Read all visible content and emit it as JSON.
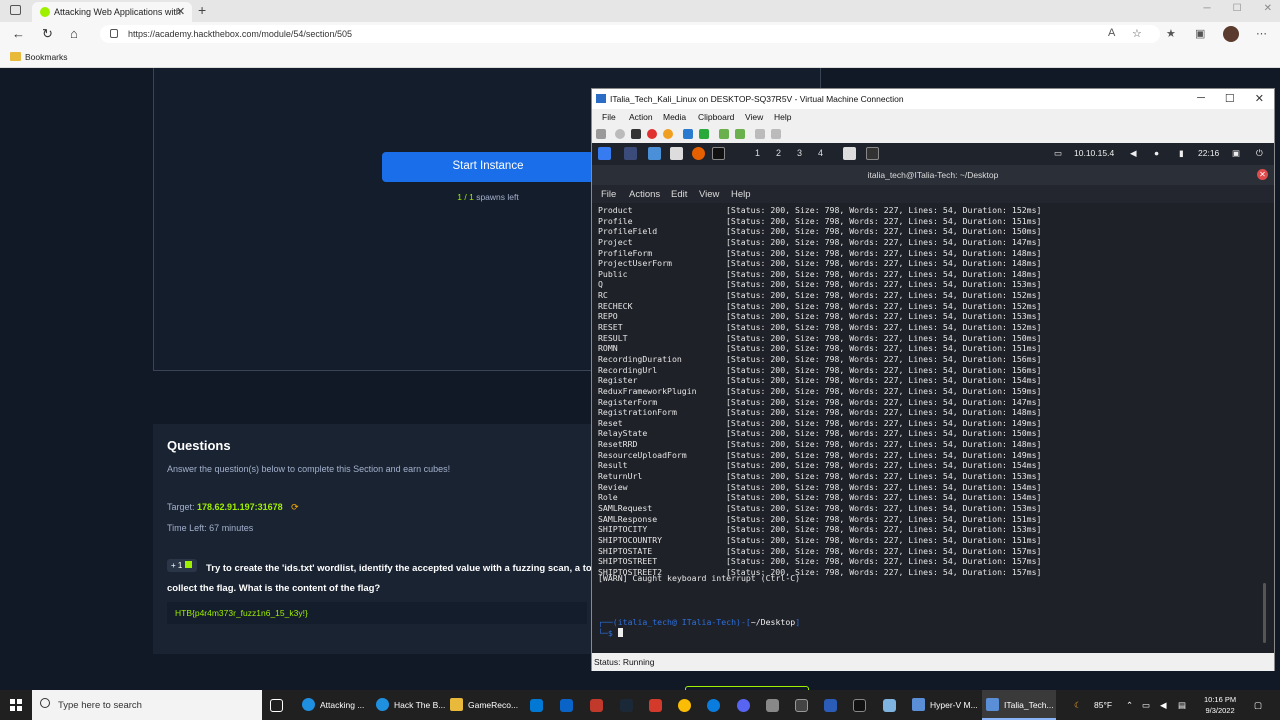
{
  "browser": {
    "tab_title": "Attacking Web Applications with",
    "url": "https://academy.hackthebox.com/module/54/section/505",
    "bookmarks_label": "Bookmarks"
  },
  "page": {
    "start_button": "Start Instance",
    "spawns_count": "1 / 1",
    "spawns_text": "spawns left",
    "questions_title": "Questions",
    "questions_desc": "Answer the question(s) below to complete this Section and earn cubes!",
    "target_label": "Target:",
    "target_ip": "178.62.91.197:31678",
    "time_left": "Time Left: 67 minutes",
    "cube_reward": "+ 1",
    "question_text": "Try to create the 'ids.txt' wordlist, identify the accepted value with a fuzzing scan, a to collect the flag. What is the content of the flag?",
    "flag": "HTB{p4r4m373r_fuzz1n6_15_k3y!}"
  },
  "vm": {
    "title": "ITalia_Tech_Kali_Linux on DESKTOP-SQ37R5V - Virtual Machine Connection",
    "menu": [
      "File",
      "Action",
      "Media",
      "Clipboard",
      "View",
      "Help"
    ],
    "status": "Status: Running",
    "kali": {
      "workspaces": [
        "1",
        "2",
        "3",
        "4"
      ],
      "ip": "10.10.15.4",
      "time": "22:16"
    },
    "terminal": {
      "title": "italia_tech@ITalia-Tech: ~/Desktop",
      "menu": [
        "File",
        "Actions",
        "Edit",
        "View",
        "Help"
      ],
      "rows": [
        [
          "Product",
          "[Status: 200, Size: 798, Words: 227, Lines: 54, Duration: 152ms]"
        ],
        [
          "Profile",
          "[Status: 200, Size: 798, Words: 227, Lines: 54, Duration: 151ms]"
        ],
        [
          "ProfileField",
          "[Status: 200, Size: 798, Words: 227, Lines: 54, Duration: 150ms]"
        ],
        [
          "Project",
          "[Status: 200, Size: 798, Words: 227, Lines: 54, Duration: 147ms]"
        ],
        [
          "ProfileForm",
          "[Status: 200, Size: 798, Words: 227, Lines: 54, Duration: 148ms]"
        ],
        [
          "ProjectUserForm",
          "[Status: 200, Size: 798, Words: 227, Lines: 54, Duration: 148ms]"
        ],
        [
          "Public",
          "[Status: 200, Size: 798, Words: 227, Lines: 54, Duration: 148ms]"
        ],
        [
          "Q",
          "[Status: 200, Size: 798, Words: 227, Lines: 54, Duration: 153ms]"
        ],
        [
          "RC",
          "[Status: 200, Size: 798, Words: 227, Lines: 54, Duration: 152ms]"
        ],
        [
          "RECHECK",
          "[Status: 200, Size: 798, Words: 227, Lines: 54, Duration: 152ms]"
        ],
        [
          "REPO",
          "[Status: 200, Size: 798, Words: 227, Lines: 54, Duration: 153ms]"
        ],
        [
          "RESET",
          "[Status: 200, Size: 798, Words: 227, Lines: 54, Duration: 152ms]"
        ],
        [
          "RESULT",
          "[Status: 200, Size: 798, Words: 227, Lines: 54, Duration: 150ms]"
        ],
        [
          "ROMN",
          "[Status: 200, Size: 798, Words: 227, Lines: 54, Duration: 151ms]"
        ],
        [
          "RecordingDuration",
          "[Status: 200, Size: 798, Words: 227, Lines: 54, Duration: 156ms]"
        ],
        [
          "RecordingUrl",
          "[Status: 200, Size: 798, Words: 227, Lines: 54, Duration: 156ms]"
        ],
        [
          "Register",
          "[Status: 200, Size: 798, Words: 227, Lines: 54, Duration: 154ms]"
        ],
        [
          "ReduxFrameworkPlugin",
          "[Status: 200, Size: 798, Words: 227, Lines: 54, Duration: 159ms]"
        ],
        [
          "RegisterForm",
          "[Status: 200, Size: 798, Words: 227, Lines: 54, Duration: 147ms]"
        ],
        [
          "RegistrationForm",
          "[Status: 200, Size: 798, Words: 227, Lines: 54, Duration: 148ms]"
        ],
        [
          "Reset",
          "[Status: 200, Size: 798, Words: 227, Lines: 54, Duration: 149ms]"
        ],
        [
          "RelayState",
          "[Status: 200, Size: 798, Words: 227, Lines: 54, Duration: 150ms]"
        ],
        [
          "ResetRRD",
          "[Status: 200, Size: 798, Words: 227, Lines: 54, Duration: 148ms]"
        ],
        [
          "ResourceUploadForm",
          "[Status: 200, Size: 798, Words: 227, Lines: 54, Duration: 149ms]"
        ],
        [
          "Result",
          "[Status: 200, Size: 798, Words: 227, Lines: 54, Duration: 154ms]"
        ],
        [
          "ReturnUrl",
          "[Status: 200, Size: 798, Words: 227, Lines: 54, Duration: 153ms]"
        ],
        [
          "Review",
          "[Status: 200, Size: 798, Words: 227, Lines: 54, Duration: 154ms]"
        ],
        [
          "Role",
          "[Status: 200, Size: 798, Words: 227, Lines: 54, Duration: 154ms]"
        ],
        [
          "SAMLRequest",
          "[Status: 200, Size: 798, Words: 227, Lines: 54, Duration: 153ms]"
        ],
        [
          "SAMLResponse",
          "[Status: 200, Size: 798, Words: 227, Lines: 54, Duration: 151ms]"
        ],
        [
          "SHIPTOCITY",
          "[Status: 200, Size: 798, Words: 227, Lines: 54, Duration: 153ms]"
        ],
        [
          "SHIPTOCOUNTRY",
          "[Status: 200, Size: 798, Words: 227, Lines: 54, Duration: 151ms]"
        ],
        [
          "SHIPTOSTATE",
          "[Status: 200, Size: 798, Words: 227, Lines: 54, Duration: 157ms]"
        ],
        [
          "SHIPTOSTREET",
          "[Status: 200, Size: 798, Words: 227, Lines: 54, Duration: 157ms]"
        ],
        [
          "SHIPTOSTREET2",
          "[Status: 200, Size: 798, Words: 227, Lines: 54, Duration: 157ms]"
        ]
      ],
      "warn": "[WARN] Caught keyboard interrupt (Ctrl-C)",
      "prompt_user": "(italia_tech@ ITalia-Tech)",
      "prompt_dir": "~/Desktop",
      "prompt_symbol": "$"
    }
  },
  "taskbar": {
    "search_placeholder": "Type here to search",
    "apps": [
      "Attacking ...",
      "Hack The B...",
      "GameReco...",
      "Hyper-V M...",
      "ITalia_Tech..."
    ],
    "weather": "85°F",
    "time": "10:16 PM",
    "date": "9/3/2022"
  }
}
